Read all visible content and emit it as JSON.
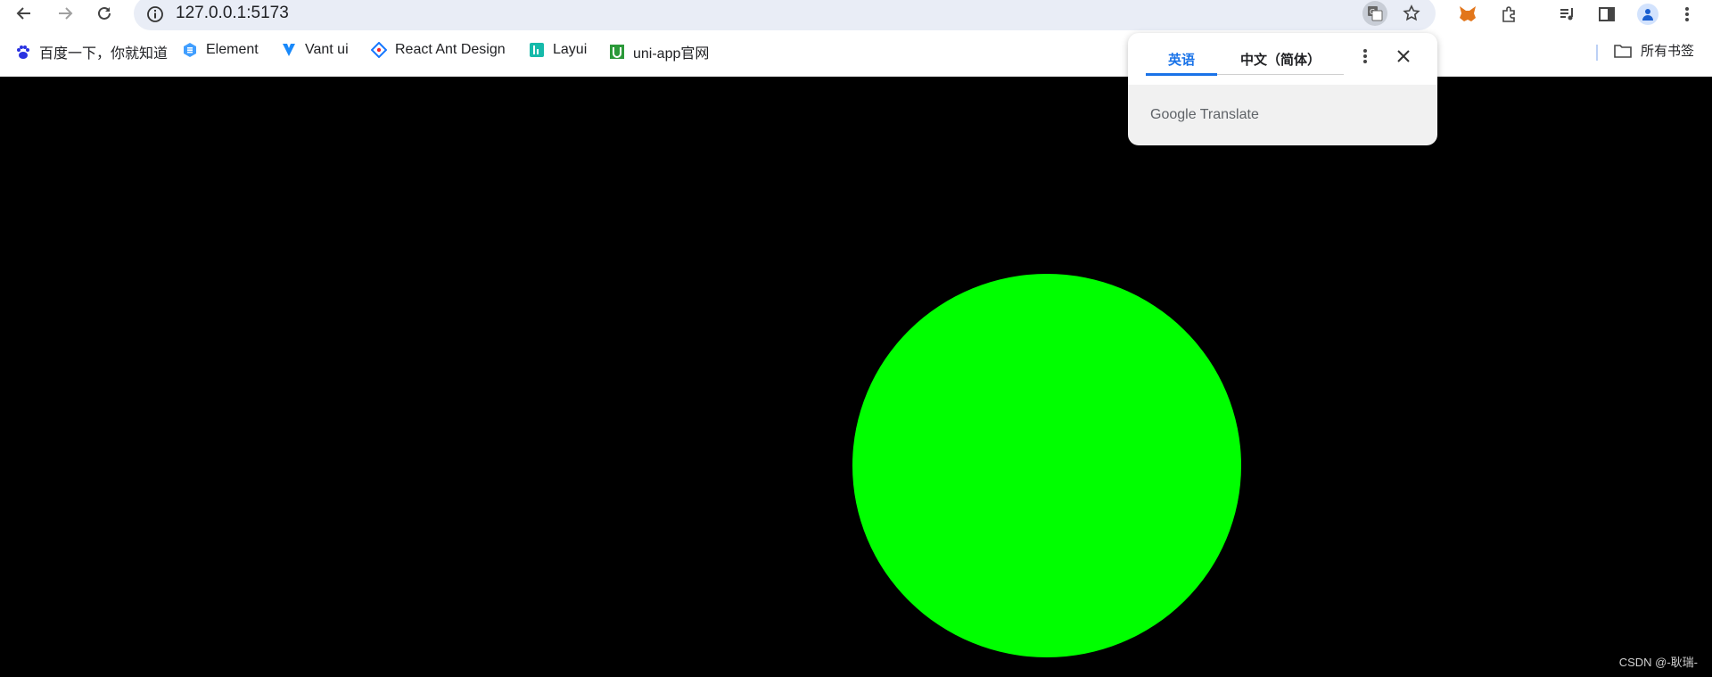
{
  "browser": {
    "url": "127.0.0.1:5173",
    "bookmarks": [
      {
        "label": "百度一下，你就知道",
        "icon": "baidu-paw-icon",
        "color": "#2932e1"
      },
      {
        "label": "Element",
        "icon": "element-logo-icon",
        "color": "#409eff"
      },
      {
        "label": "Vant ui",
        "icon": "vant-logo-icon",
        "color": "#1989fa"
      },
      {
        "label": "React Ant Design",
        "icon": "ant-design-logo-icon",
        "color": "#1677ff"
      },
      {
        "label": "Layui",
        "icon": "layui-logo-icon",
        "color": "#16baaa"
      },
      {
        "label": "uni-app官网",
        "icon": "uniapp-logo-icon",
        "color": "#2b9939"
      }
    ],
    "all_bookmarks_label": "所有书签"
  },
  "translate_popup": {
    "source_lang": "英语",
    "target_lang": "中文（简体）",
    "brand_google": "Google",
    "brand_translate": "Translate"
  },
  "page": {
    "circle_color": "#00ff00",
    "background": "#000000",
    "watermark": "CSDN @-耿瑞-"
  }
}
